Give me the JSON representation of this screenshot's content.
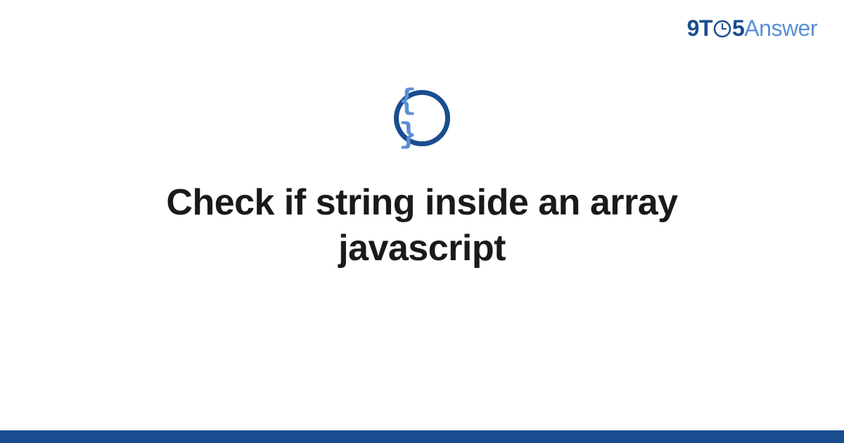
{
  "logo": {
    "part1": "9T",
    "part2": "5",
    "part3": "Answer"
  },
  "icon": {
    "braces": "{ }"
  },
  "title": "Check if string inside an array javascript",
  "colors": {
    "primary": "#1a4d8f",
    "secondary": "#5a8fd4",
    "text": "#1a1a1a"
  }
}
